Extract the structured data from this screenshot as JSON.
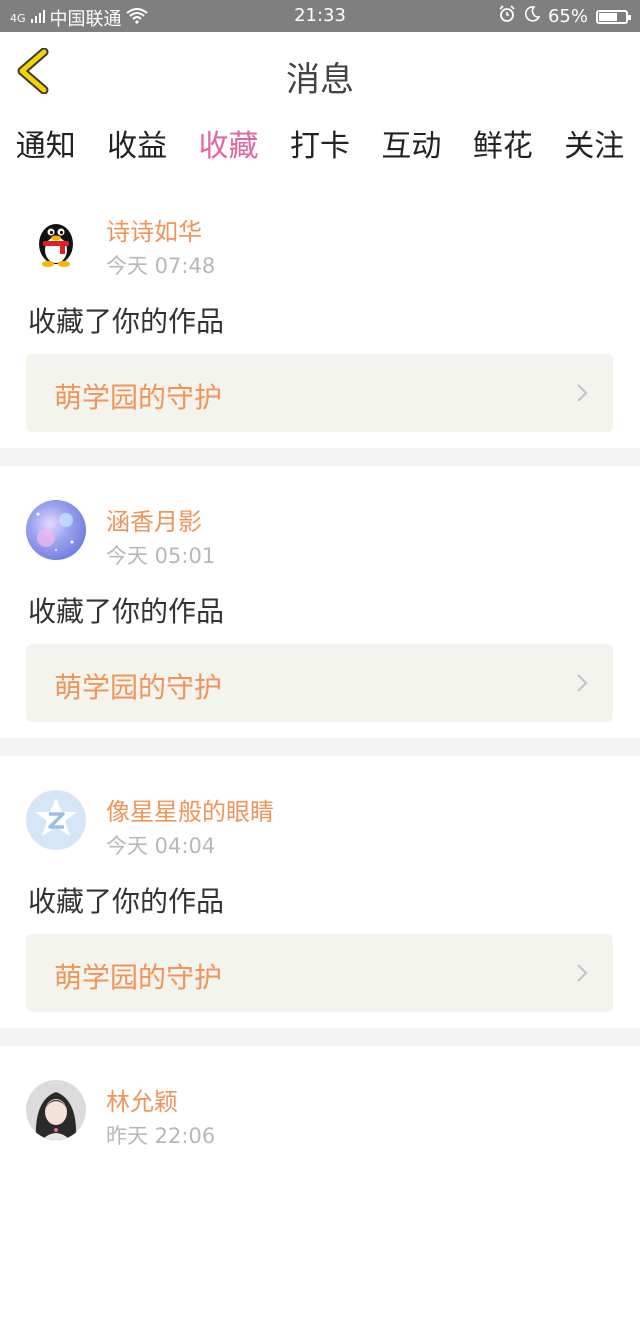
{
  "status_bar": {
    "network": "4G",
    "carrier": "中国联通",
    "time": "21:33",
    "battery": "65%",
    "battery_level": 0.65
  },
  "header": {
    "title": "消息"
  },
  "tabs": [
    {
      "label": "通知",
      "active": false
    },
    {
      "label": "收益",
      "active": false
    },
    {
      "label": "收藏",
      "active": true
    },
    {
      "label": "打卡",
      "active": false
    },
    {
      "label": "互动",
      "active": false
    },
    {
      "label": "鲜花",
      "active": false
    },
    {
      "label": "关注",
      "active": false
    }
  ],
  "colors": {
    "accent": "#e066a0",
    "name": "#f0955a",
    "time": "#b8b8b8"
  },
  "messages": [
    {
      "name": "诗诗如华",
      "time": "今天 07:48",
      "action": "收藏了你的作品",
      "work": "萌学园的守护",
      "avatar_icon": "qq-penguin-icon"
    },
    {
      "name": "涵香月影",
      "time": "今天 05:01",
      "action": "收藏了你的作品",
      "work": "萌学园的守护",
      "avatar_icon": "galaxy-avatar"
    },
    {
      "name": "像星星般的眼睛",
      "time": "今天 04:04",
      "action": "收藏了你的作品",
      "work": "萌学园的守护",
      "avatar_icon": "default-z-avatar"
    },
    {
      "name": "林允颖",
      "time": "昨天 22:06",
      "action": "",
      "work": "",
      "avatar_icon": "photo-avatar"
    }
  ]
}
